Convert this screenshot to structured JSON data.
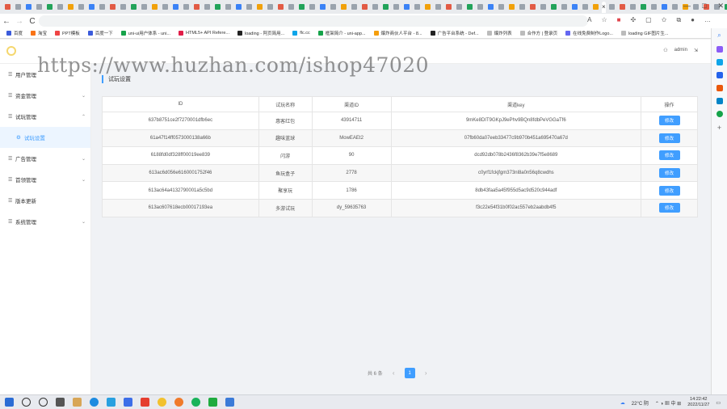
{
  "browser": {
    "active_tab_close": "×",
    "new_tab": "+",
    "window_controls": {
      "minimize": "—",
      "maximize": "□",
      "close": "✕"
    },
    "nav": {
      "back": "←",
      "forward": "→",
      "reload": "C"
    },
    "address_bar": "",
    "bookmarks": [
      "百度",
      "淘宝",
      "PPT模板",
      "百度一下",
      "uni-ui用户体系 - uni...",
      "HTML5+ API Refere...",
      "loading - 阿页简用...",
      "flc.cc",
      "框架简介 - uni-app...",
      "爆炸商伙人平台 - 8...",
      "广告平台系统 - Def...",
      "爆炸列表",
      "合作方 | 登录页",
      "在线免费制作Logo...",
      "loading GIF图片生..."
    ]
  },
  "app": {
    "header": {
      "user": "admin",
      "user_icon": "user-icon",
      "logout_icon": "logout-icon"
    },
    "sidebar": [
      {
        "label": "用户管理",
        "has_children": false
      },
      {
        "label": "资金管理",
        "has_children": true
      },
      {
        "label": "试玩管理",
        "has_children": true,
        "expanded": true,
        "children": [
          {
            "label": "试玩设置",
            "active": true
          }
        ]
      },
      {
        "label": "广告管理",
        "has_children": true
      },
      {
        "label": "首领管理",
        "has_children": true
      },
      {
        "label": "版本更新",
        "has_children": false
      },
      {
        "label": "系统管理",
        "has_children": true
      }
    ],
    "watermark": "https://www.huzhan.com/ishop47020",
    "breadcrumb": "试玩设置",
    "table": {
      "columns": [
        "ID",
        "试玩名称",
        "渠道ID",
        "渠道key",
        "操作"
      ],
      "action_label": "修改",
      "rows": [
        {
          "id": "637b8751ce2f7270001dfb6ec",
          "name": "惠客红包",
          "channel_id": "43914711",
          "key": "9mKe8DIT9GKpJ9ePhv9BQn8fdbPeVGGaTf6"
        },
        {
          "id": "61a47f14ff0573000138a66b",
          "name": "趣味蓝球",
          "channel_id": "MowEAEt2",
          "key": "07fb60da07eeb33477c9b970b451a695470a67d"
        },
        {
          "id": "6188fd0df328ff00019ee839",
          "name": "闪游",
          "channel_id": "90",
          "key": "dcd92db078b2436f8362b39e7f5e8689"
        },
        {
          "id": "613ac6d056e6160001752f46",
          "name": "鱼玩盒子",
          "channel_id": "2778",
          "key": "c0yrf1fckjfgm373nl8a0n56q8cwdhs"
        },
        {
          "id": "613ac64a4132790001a5c5bd",
          "name": "聚享玩",
          "channel_id": "1786",
          "key": "8db43faa5a45f955d5ac9d520c944adf"
        },
        {
          "id": "613ac607618ecb00017193ea",
          "name": "多游试玩",
          "channel_id": "dy_59635763",
          "key": "f3c22e54f31b0f02ac557eb2aabdb4f5"
        }
      ]
    },
    "pagination": {
      "total": "共 6 条",
      "prev": "‹",
      "current": "1",
      "next": "›"
    }
  },
  "taskbar": {
    "weather": "22°C 阴",
    "time": "14:22:42",
    "date": "2022/11/27"
  }
}
